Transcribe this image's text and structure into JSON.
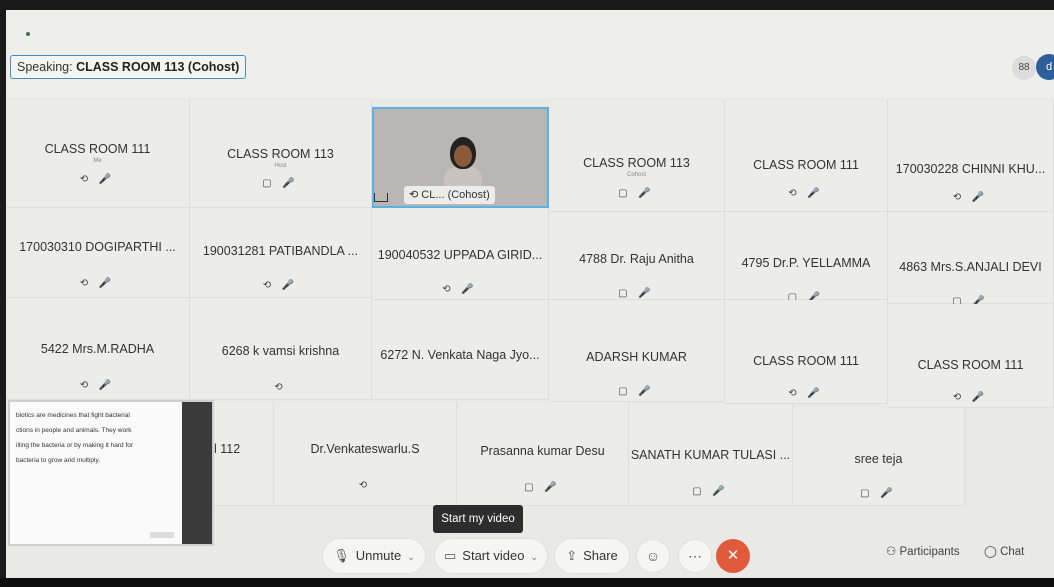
{
  "header": {
    "speaking_prefix": "Speaking: ",
    "speaking_name": "CLASS ROOM 113 (Cohost)",
    "layout_icon": "grid-layout-icon",
    "layout_glyph": "88"
  },
  "grid": {
    "row1": [
      {
        "name": "CLASS ROOM 111",
        "role": "Me",
        "icons": "⟲ 🎤"
      },
      {
        "name": "CLASS ROOM 113",
        "role": "Host",
        "icons": "▢ 🎤"
      },
      {
        "name": "CLASS ROOM 113",
        "role": "Cohost",
        "icons": "▢ 🎤"
      },
      {
        "name": "CLASS ROOM 111",
        "role": "",
        "icons": "⟲ 🎤"
      },
      {
        "name": "170030228 CHINNI KHU...",
        "role": "",
        "icons": "⟲ 🎤"
      }
    ],
    "video_label": "CL... (Cohost)",
    "row2": [
      {
        "name": "170030310 DOGIPARTHI ...",
        "icons": "⟲ 🎤"
      },
      {
        "name": "190031281 PATIBANDLA ...",
        "icons": "⟲ 🎤"
      },
      {
        "name": "190040532 UPPADA GIRID...",
        "icons": "⟲ 🎤"
      },
      {
        "name": "4788 Dr. Raju Anitha",
        "icons": "▢ 🎤"
      },
      {
        "name": "4795 Dr.P. YELLAMMA",
        "icons": "▢ 🎤"
      },
      {
        "name": "4863 Mrs.S.ANJALI DEVI",
        "icons": "▢ 🎤"
      }
    ],
    "row3": [
      {
        "name": "5422 Mrs.M.RADHA",
        "icons": "⟲ 🎤"
      },
      {
        "name": "6268 k vamsi krishna",
        "icons": "⟲"
      },
      {
        "name": "6272 N. Venkata Naga Jyo...",
        "icons": ""
      },
      {
        "name": "ADARSH KUMAR",
        "icons": "▢ 🎤"
      },
      {
        "name": "CLASS ROOM 111",
        "icons": "⟲ 🎤"
      },
      {
        "name": "CLASS ROOM 111",
        "icons": "⟲ 🎤"
      }
    ],
    "row4": [
      {
        "name": "l 112",
        "icons": ""
      },
      {
        "name": "Dr.Venkateswarlu.S",
        "icons": "⟲"
      },
      {
        "name": "Prasanna kumar Desu",
        "icons": "▢ 🎤"
      },
      {
        "name": "SANATH KUMAR TULASI ...",
        "icons": "▢ 🎤"
      },
      {
        "name": "sree teja",
        "icons": "▢ 🎤"
      }
    ]
  },
  "slide": {
    "lines": [
      "biotics are medicines that fight bacterial",
      "ctions in people and animals. They work",
      "illing the bacteria or by making it hard for",
      "bacteria to grow and multiply."
    ]
  },
  "tooltip": "Start my video",
  "toolbar": {
    "unmute": "Unmute",
    "start_video": "Start video",
    "share": "Share",
    "participants": "Participants",
    "chat": "Chat"
  },
  "colors": {
    "accent": "#5bb0e6",
    "end_call": "#e15a3c",
    "muted_mic": "#cc4444"
  }
}
